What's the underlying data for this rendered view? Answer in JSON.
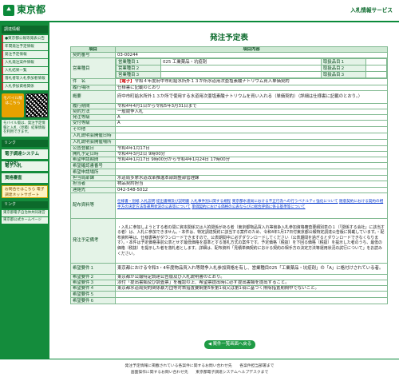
{
  "header": {
    "logo_mark": "⯅",
    "logo_text": "東京都",
    "system_title": "入札情報サービス"
  },
  "sidebar": {
    "menu_heading": "調達情報",
    "items": [
      "●東京都公報等発表公告",
      "年間発注予定情報",
      "発注予定情報",
      "入札発注案件情報",
      "入札結果一覧",
      "落札者等入札参加者情報",
      "入札参加資格関係"
    ],
    "mobile_label": "モバイル版はこちら",
    "note": "モバイル版は、発注予定情報と入札（見積）結果情報を利用できます。",
    "links_heading": "リンク",
    "big_links": [
      "電子調達システム(TOP)",
      "電子入札",
      "資格審査"
    ],
    "contact": "お問合せはこちら 電子調達ネットサポート",
    "extra_heading": "リンク",
    "extra_links": [
      "東京都電子自治体共同運営",
      "東京都公式ホームページ"
    ]
  },
  "main": {
    "title": "発注予定表",
    "col_item": "項目",
    "col_content": "項目内容",
    "rows": {
      "contract_no_label": "契約番号",
      "contract_no": "03-00244",
      "category_label": "営業種目",
      "categories": [
        {
          "label": "営業種目１",
          "value": "025 工業薬品・坑疫剤",
          "sub_label": "取扱品目１",
          "sub_value": ""
        },
        {
          "label": "営業種目２",
          "value": "",
          "sub_label": "取扱品目２",
          "sub_value": ""
        },
        {
          "label": "営業種目３",
          "value": "",
          "sub_label": "取扱品目３",
          "sub_value": ""
        }
      ],
      "subject_label": "件　名",
      "subject_tag": "【電子】",
      "subject": "令和４年度府中市町給水所外１３か所水道用次亜塩素酸ナトリウム買入単価契約",
      "place_label": "履行場所",
      "place": "仕様書に記載のとおり",
      "summary_label": "概要",
      "summary": "府中市町給水所外１３か所で使用する水道用次亜塩素酸ナトリウムを買い入れる（単価契約）（詳細は仕様書に記載のとおり。）",
      "period_label": "履行期間",
      "period": "令和4年4月1日から令和5年3月31日まで",
      "method_label": "契約方法",
      "method": "一般競争入札",
      "issue_label": "発注等級",
      "issue": "A",
      "accept_label": "受付等級",
      "accept": "A",
      "other_label": "その他",
      "other": "",
      "meeting_date_label": "入札説明会開催日時",
      "meeting_date": "",
      "meeting_place_label": "入札説明会開催場所",
      "meeting_place": "",
      "announce_label": "公告登載日",
      "announce": "令和4年1月17日",
      "open_label": "開札予定日時",
      "open": "令和4年3月2日 9時00分",
      "apply_label": "希望申請期間",
      "apply": "令和4年1月17日 9時00分から令和4年1月24日 17時00分",
      "confirm_label": "希望確認書番号",
      "confirm": "",
      "hope_label": "希望申請場所",
      "hope": "",
      "dept_label": "担当局部課",
      "dept": "水道局多摩水道改革推進本部調整部管理課",
      "person_label": "担当者",
      "person": "物品契約担当",
      "contact_label": "連絡先",
      "contact": "042-548-5012",
      "docs_label": "配布資料等",
      "docs": [
        "仕様書・別紙",
        "入札説明",
        "提出書類及び説明書",
        "入札事件別に関する規程",
        "東京都水道局における不正行為への行うペナルティ強化について",
        "随意契約における契約の相手方の決定方法等運用状況の公表等について",
        "単価契約における価格の公表ならびに総合評価に係る基準等について"
      ],
      "remarks_label": "発注予定備考",
      "remarks": "・入札に参加しようとする者の間に資本関係又は人的関係がある者（東京都物品買入れ等競争入札参加資格審査要綱別表の１（「関係する会社」に該当する者）は、入札に参加できません。・本件は、特定調達契約に該当する案件のため、令和4年1月17日付東京都公報特定調達公告版に掲載しています。・配布資料等は、仕様書等がダウンロードできますので、公表期間中に必ずダウンロードしてください（公表期間を過ぎるとダウンロードできなくなります）。・本件は予定価格事前公表とせず最低価格を基準とする落札方式の案件です。予定価格（税抜）を下回る価格（税抜）を提示した者のうち、最低の価格（税抜）を提示した者を落札者とします。詳細は、配布資料「見積単価契約における契約の相手方の決定方法等運用状況の試行について」をお読みください。",
      "req1_label": "希望要件１",
      "req1": "東京都における令和3・4年度物品買入れ等競争入札参加資格を有し、営業種目025「工業薬品・坑疫剤」の「A」に格付けされている者。",
      "req2_label": "希望要件２",
      "req2": "東京都が公報特定調達公告版及び入札説明書のとおり。",
      "req3_label": "希望要件３",
      "req3": "添付「提出書類及び調査票」を確認の上、希望票提出時に必ず提出書類を提出すること。",
      "req4_label": "希望要件４",
      "req4": "東京都水道局契約関係暴力団等対策措置要綱第5条第1項又は第1項に基づく排除措置期間中でないこと。",
      "req5_label": "希望要件５",
      "req5": "",
      "req6_label": "希望要件６",
      "req6": ""
    },
    "back_button": "◀ 案件一覧画面へ戻る"
  },
  "footer": {
    "line1": "発注予定情報に掲載されている各案件に関するお問い合わせ先　　各案件担当部署まで",
    "line2": "画面操作に関するお問い合わせ先　　東京都電子調達システムヘルプデスクまで"
  }
}
